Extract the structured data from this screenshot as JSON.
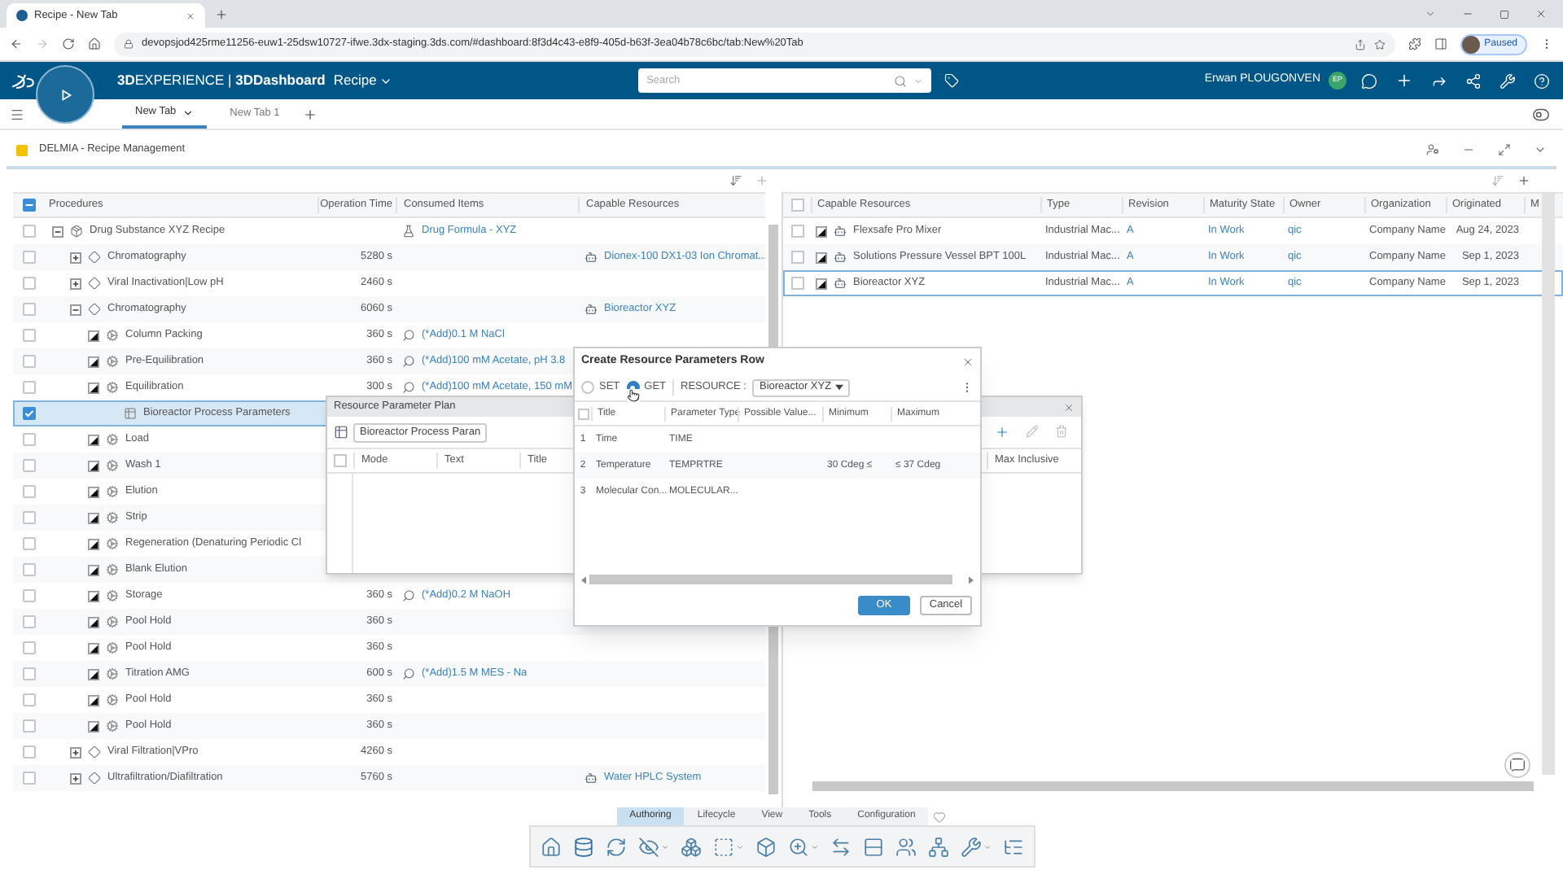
{
  "browser": {
    "tab_title": "Recipe - New Tab",
    "url": "devopsjod425rme11256-euw1-25dsw10727-ifwe.3dx-staging.3ds.com/#dashboard:8f3d4c43-e8f9-405d-b63f-3ea04b78c6bc/tab:New%20Tab",
    "profile": "Paused"
  },
  "topbar": {
    "title": "**3D**EXPERIENCE | **3DDashboard**",
    "app": "Recipe",
    "search_placeholder": "Search",
    "user": "Erwan PLOUGONVEN",
    "initials": "EP"
  },
  "tabs": [
    {
      "label": "New Tab",
      "selected": true
    },
    {
      "label": "New Tab 1",
      "selected": false
    }
  ],
  "widget": {
    "title": "DELMIA - Recipe Management"
  },
  "procedures": {
    "header_partial": true,
    "columns": [
      "Procedures",
      "Operation Time",
      "Consumed Items",
      "Capable Resources"
    ],
    "rows": [
      {
        "kind": "recipe",
        "name": "Drug Substance XYZ Recipe",
        "consumed": {
          "kind": "formula",
          "text": "Drug Formula - XYZ"
        },
        "selected": false,
        "expanded": true,
        "children": [
          {
            "kind": "operation",
            "name": "Chromatography",
            "time": "5280 s",
            "resource": "Dionex-100 DX1-03 Ion Chromat...",
            "selected": false,
            "expanded": false
          },
          {
            "kind": "operation",
            "name": "Viral Inactivation|Low pH",
            "time": "2460 s",
            "selected": false,
            "expanded": false
          },
          {
            "kind": "operation",
            "name": "Chromatography",
            "time": "6060 s",
            "resource": "Bioreactor XYZ",
            "selected": false,
            "expanded": true,
            "children": [
              {
                "kind": "step",
                "name": "Column Packing",
                "time": "360 s",
                "consumed": {
                  "kind": "material",
                  "text": "(*Add)0.1 M NaCl"
                },
                "selected": false
              },
              {
                "kind": "step",
                "name": "Pre-Equilibration",
                "time": "360 s",
                "consumed": {
                  "kind": "material",
                  "text": "(*Add)100 mM Acetate, pH 3.8"
                },
                "selected": false
              },
              {
                "kind": "step",
                "name": "Equilibration",
                "time": "300 s",
                "consumed": {
                  "kind": "material",
                  "text": "(*Add)100 mM Acetate, 150 mM"
                },
                "selected": false,
                "children": [
                  {
                    "kind": "parameters",
                    "name": "Bioreactor Process Parameters",
                    "selected": true
                  }
                ]
              },
              {
                "kind": "step",
                "name": "Load",
                "selected": false
              },
              {
                "kind": "step",
                "name": "Wash 1",
                "selected": false
              },
              {
                "kind": "step",
                "name": "Elution",
                "selected": false
              },
              {
                "kind": "step",
                "name": "Strip",
                "selected": false
              },
              {
                "kind": "step",
                "name": "Regeneration (Denaturing Periodic Cl",
                "selected": false
              },
              {
                "kind": "step",
                "name": "Blank Elution",
                "selected": false
              },
              {
                "kind": "step",
                "name": "Storage",
                "time": "360 s",
                "consumed": {
                  "kind": "material",
                  "text": "(*Add)0.2 M NaOH"
                },
                "selected": false
              },
              {
                "kind": "step",
                "name": "Pool Hold",
                "time": "360 s",
                "selected": false
              },
              {
                "kind": "step",
                "name": "Pool Hold",
                "time": "360 s",
                "selected": false
              },
              {
                "kind": "step",
                "name": "Titration AMG",
                "time": "600 s",
                "consumed": {
                  "kind": "material",
                  "text": "(*Add)1.5 M MES - Na"
                },
                "selected": false
              },
              {
                "kind": "step",
                "name": "Pool Hold",
                "time": "360 s",
                "selected": false
              },
              {
                "kind": "step",
                "name": "Pool Hold",
                "time": "360 s",
                "selected": false
              }
            ]
          },
          {
            "kind": "operation",
            "name": "Viral Filtration|VPro",
            "time": "4260 s",
            "selected": false,
            "expanded": false
          },
          {
            "kind": "operation",
            "name": "Ultrafiltration/Diafiltration",
            "time": "5760 s",
            "resource": "Water HPLC System",
            "selected": false,
            "expanded": false
          }
        ]
      }
    ]
  },
  "resources": {
    "header_checked": false,
    "columns": [
      "Capable Resources",
      "Type",
      "Revision",
      "Maturity State",
      "Owner",
      "Organization",
      "Originated",
      "M"
    ],
    "rows": [
      {
        "name": "Flexsafe Pro Mixer",
        "type": "Industrial Mac...",
        "revision": "A",
        "maturity": "In Work",
        "owner": "qic",
        "organization": "Company Name",
        "originated": "Aug 24, 2023",
        "selected": false
      },
      {
        "name": "Solutions Pressure Vessel BPT 100L",
        "type": "Industrial Mac...",
        "revision": "A",
        "maturity": "In Work",
        "owner": "qic",
        "organization": "Company Name",
        "originated": "Sep 1, 2023",
        "selected": false
      },
      {
        "name": "Bioreactor XYZ",
        "type": "Industrial Mac...",
        "revision": "A",
        "maturity": "In Work",
        "owner": "qic",
        "organization": "Company Name",
        "originated": "Sep 1, 2023",
        "selected": true
      }
    ]
  },
  "parameter_plan": {
    "header_checked": false,
    "title": "Resource Parameter Plan",
    "plan": "Bioreactor Process Paran",
    "columns": [
      "Mode",
      "Text",
      "Title"
    ],
    "last_column": "Max Inclusive"
  },
  "dialog": {
    "header_checked": false,
    "title": "Create Resource Parameters Row",
    "modes": [
      {
        "label": "SET",
        "selected": false
      },
      {
        "label": "GET",
        "selected": true
      }
    ],
    "resource_label": "RESOURCE :",
    "resource": "Bioreactor XYZ",
    "columns": [
      "Title",
      "Parameter Type",
      "Possible Value...",
      "Minimum",
      "Maximum"
    ],
    "rows": [
      {
        "index": "1",
        "title": "Time",
        "type": "TIME"
      },
      {
        "index": "2",
        "title": "Temperature",
        "type": "TEMPRTRE",
        "minimum": "30 Cdeg ≤",
        "maximum": "≤ 37 Cdeg"
      },
      {
        "index": "3",
        "title": "Molecular Con...",
        "type": "MOLECULAR..."
      }
    ],
    "buttons": [
      {
        "label": "OK",
        "kind": "primary"
      },
      {
        "label": "Cancel",
        "kind": "secondary"
      }
    ]
  },
  "bottom_tabs": [
    {
      "label": "Authoring",
      "selected": true
    },
    {
      "label": "Lifecycle",
      "selected": false
    },
    {
      "label": "View",
      "selected": false
    },
    {
      "label": "Tools",
      "selected": false
    },
    {
      "label": "Configuration",
      "selected": false
    }
  ]
}
